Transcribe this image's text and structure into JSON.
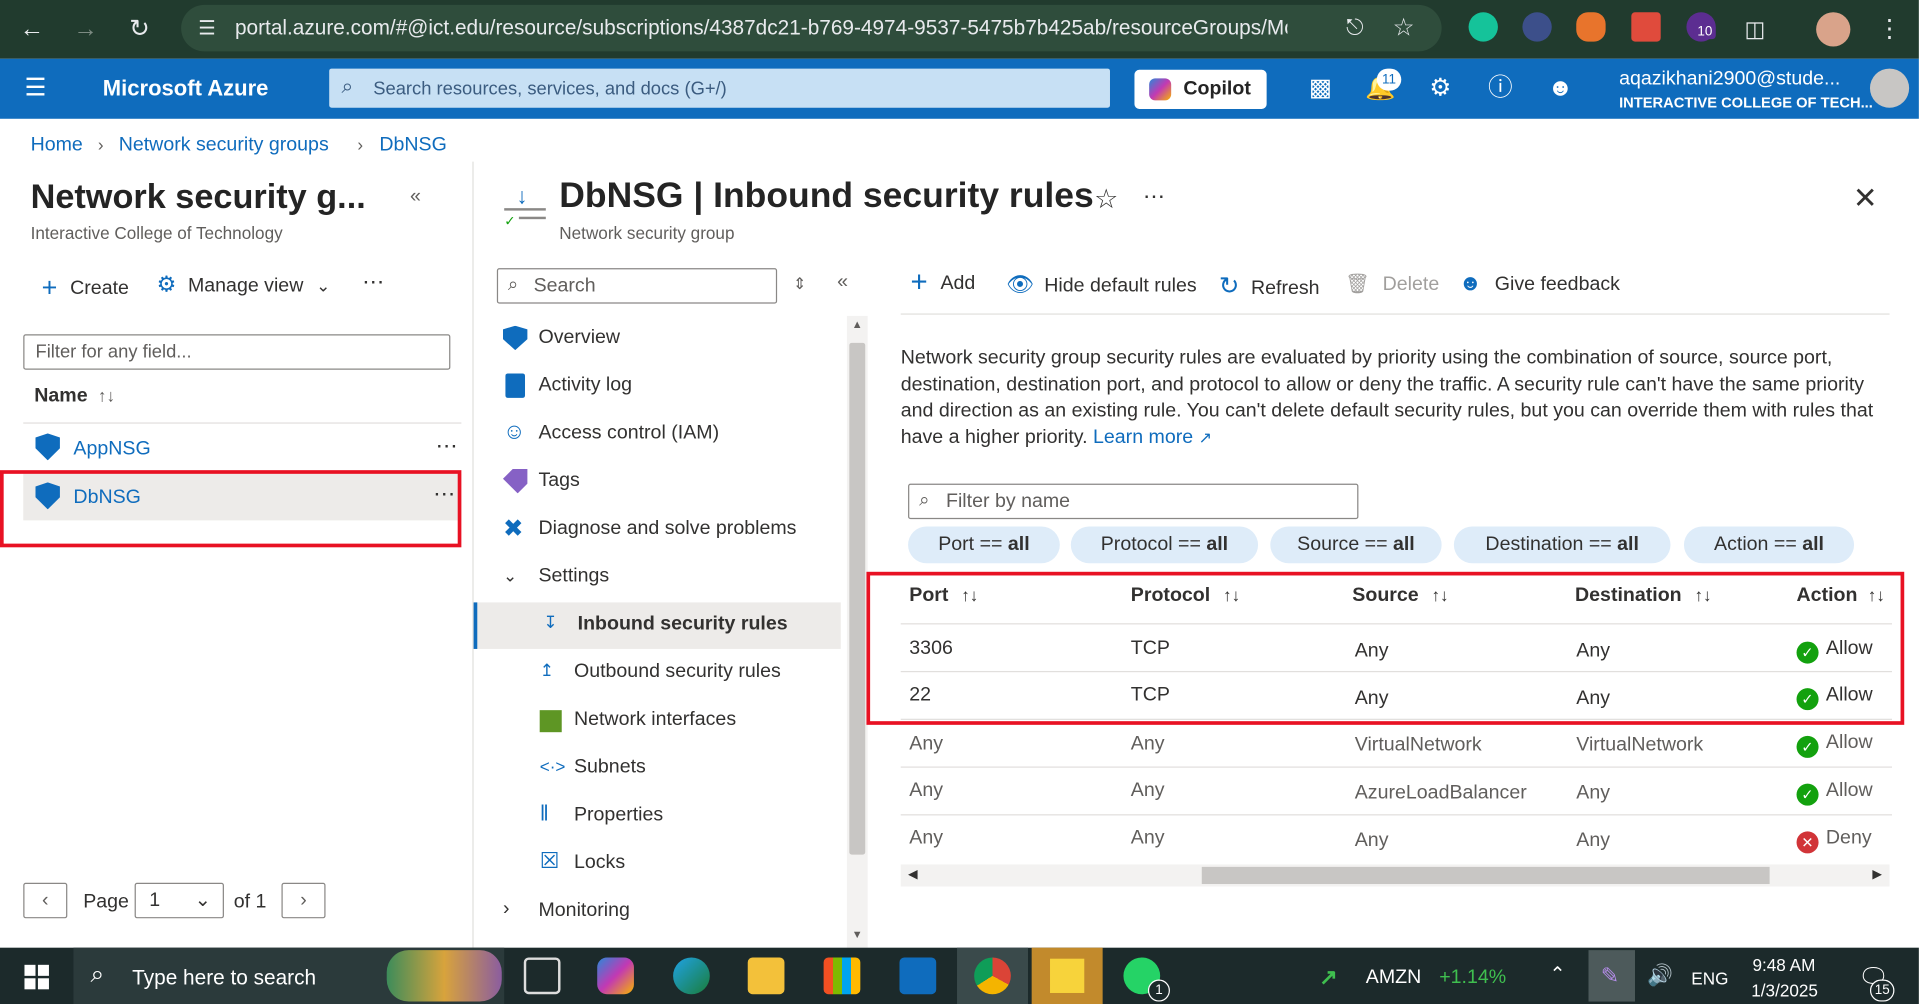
{
  "browser": {
    "url": "portal.azure.com/#@ict.edu/resource/subscriptions/4387dc21-b769-4974-9537-5475b7b425ab/resourceGroups/Mo...",
    "ext_badge": "10"
  },
  "header": {
    "brand": "Microsoft Azure",
    "search_placeholder": "Search resources, services, and docs (G+/)",
    "copilot_label": "Copilot",
    "notif_count": "11",
    "user_email": "aqazikhani2900@stude...",
    "user_org": "INTERACTIVE COLLEGE OF TECH..."
  },
  "breadcrumb": [
    "Home",
    "Network security groups",
    "DbNSG"
  ],
  "left": {
    "title": "Network security g...",
    "subtitle": "Interactive College of Technology",
    "create_label": "Create",
    "manage_view_label": "Manage view",
    "filter_placeholder": "Filter for any field...",
    "name_header": "Name",
    "items": [
      "AppNSG",
      "DbNSG"
    ],
    "page_label": "Page",
    "page_value": "1",
    "page_of": "of 1"
  },
  "blade": {
    "title": "DbNSG | Inbound security rules",
    "subtitle": "Network security group",
    "menu_search_placeholder": "Search",
    "menu": [
      {
        "label": "Overview"
      },
      {
        "label": "Activity log"
      },
      {
        "label": "Access control (IAM)"
      },
      {
        "label": "Tags"
      },
      {
        "label": "Diagnose and solve problems"
      },
      {
        "label": "Settings"
      },
      {
        "label": "Inbound security rules"
      },
      {
        "label": "Outbound security rules"
      },
      {
        "label": "Network interfaces"
      },
      {
        "label": "Subnets"
      },
      {
        "label": "Properties"
      },
      {
        "label": "Locks"
      },
      {
        "label": "Monitoring"
      }
    ],
    "toolbar": {
      "add": "Add",
      "hide_default": "Hide default rules",
      "refresh": "Refresh",
      "delete": "Delete",
      "feedback": "Give feedback"
    },
    "description": "Network security group security rules are evaluated by priority using the combination of source, source port, destination, destination port, and protocol to allow or deny the traffic. A security rule can't have the same priority and direction as an existing rule. You can't delete default security rules, but you can override them with rules that have a higher priority.",
    "learn_more": "Learn more",
    "filter_placeholder": "Filter by name",
    "pills": [
      {
        "key": "Port == ",
        "val": "all"
      },
      {
        "key": "Protocol == ",
        "val": "all"
      },
      {
        "key": "Source == ",
        "val": "all"
      },
      {
        "key": "Destination == ",
        "val": "all"
      },
      {
        "key": "Action == ",
        "val": "all"
      }
    ],
    "columns": [
      "Port",
      "Protocol",
      "Source",
      "Destination",
      "Action"
    ],
    "rows": [
      [
        "3306",
        "TCP",
        "Any",
        "Any",
        "Allow"
      ],
      [
        "22",
        "TCP",
        "Any",
        "Any",
        "Allow"
      ],
      [
        "Any",
        "Any",
        "VirtualNetwork",
        "VirtualNetwork",
        "Allow"
      ],
      [
        "Any",
        "Any",
        "AzureLoadBalancer",
        "Any",
        "Allow"
      ],
      [
        "Any",
        "Any",
        "Any",
        "Any",
        "Deny"
      ]
    ]
  },
  "taskbar": {
    "search_placeholder": "Type here to search",
    "ticker": "AMZN",
    "ticker_change": "+1.14%",
    "lang": "ENG",
    "time": "9:48 AM",
    "date": "1/3/2025",
    "whatsapp_badge": "1",
    "notif_badge": "15"
  },
  "colors": {
    "azure_blue": "#0f6cbd",
    "allow": "#13a10e",
    "deny": "#d13438",
    "highlight": "#e81123"
  }
}
